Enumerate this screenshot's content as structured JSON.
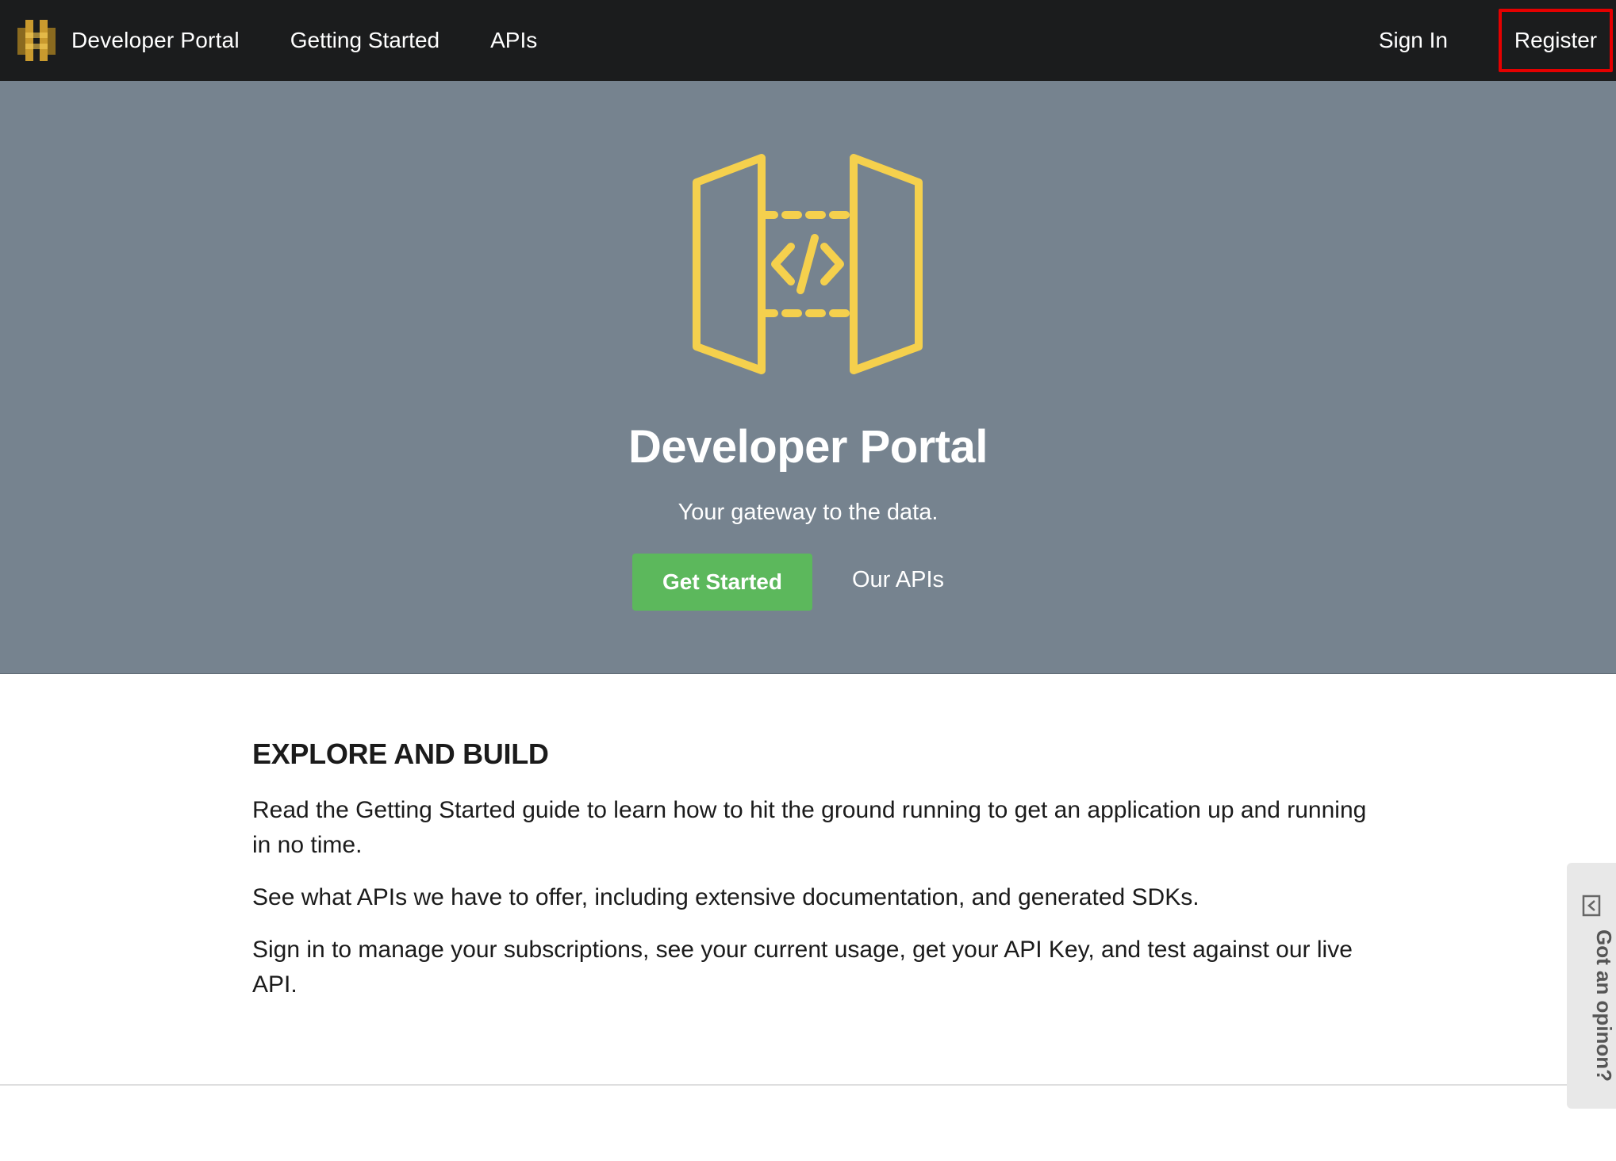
{
  "navbar": {
    "brand_label": "Developer Portal",
    "links": [
      {
        "label": "Getting Started"
      },
      {
        "label": "APIs"
      }
    ],
    "sign_in_label": "Sign In",
    "register_label": "Register"
  },
  "hero": {
    "title": "Developer Portal",
    "subtitle": "Your gateway to the data.",
    "primary_button_label": "Get Started",
    "secondary_link_label": "Our APIs"
  },
  "explore": {
    "heading": "EXPLORE AND BUILD",
    "paragraphs": [
      "Read the Getting Started guide to learn how to hit the ground running to get an application up and running in no time.",
      "See what APIs we have to offer, including extensive documentation, and generated SDKs.",
      "Sign in to manage your subscriptions, see your current usage, get your API Key, and test against our live API."
    ]
  },
  "feedback": {
    "label": "Got an opinon?"
  },
  "icons": {
    "brand": "aws-api-gateway-logo-icon",
    "hero": "api-gateway-icon",
    "feedback": "feedback-icon"
  },
  "colors": {
    "navbar": "#1b1c1d",
    "hero_background": "#76838f",
    "accent_yellow": "#f5d04d",
    "button_green": "#5cb85c",
    "register_highlight": "#e50000"
  }
}
